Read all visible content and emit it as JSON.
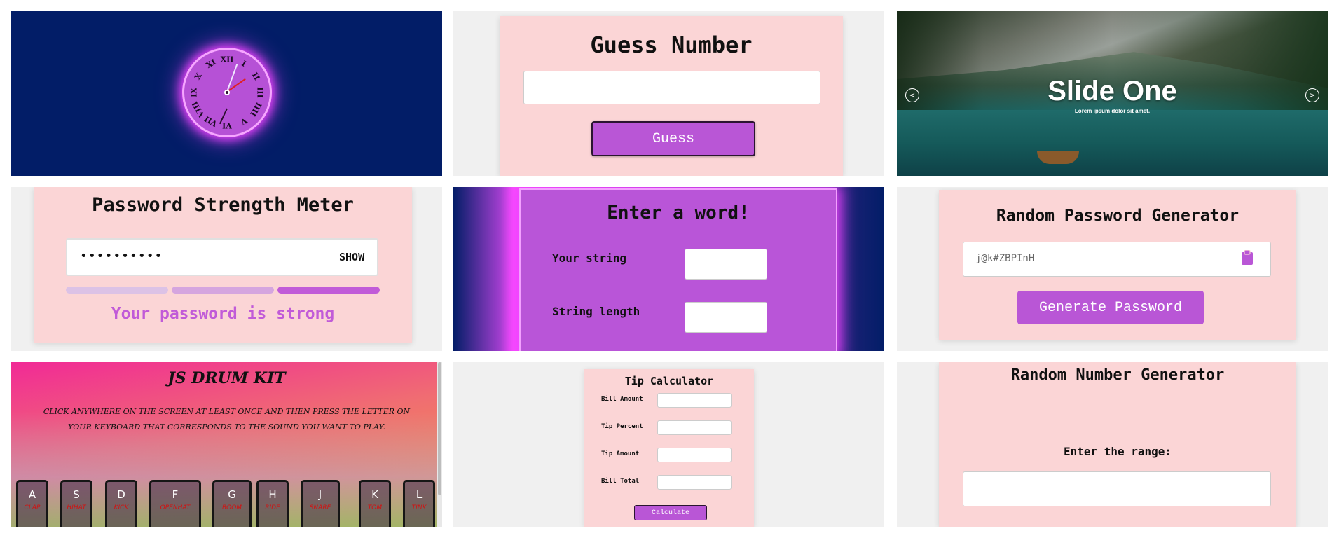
{
  "clock": {
    "numerals": [
      "XII",
      "I",
      "II",
      "III",
      "IIII",
      "V",
      "VI",
      "VII",
      "VIII",
      "IX",
      "X",
      "XI"
    ]
  },
  "guess": {
    "title": "Guess Number",
    "button": "Guess",
    "input_value": ""
  },
  "slider": {
    "title": "Slide One",
    "subtitle": "Lorem ipsum dolor sit amet.",
    "prev": "<",
    "next": ">"
  },
  "password_meter": {
    "title": "Password Strength Meter",
    "value": "••••••••••",
    "toggle": "SHOW",
    "strength_text": "Your password is strong",
    "strength_level": 3,
    "strength_max": 3
  },
  "word": {
    "title": "Enter a word!",
    "string_label": "Your string",
    "length_label": "String length"
  },
  "generator": {
    "title": "Random Password Generator",
    "password": "j@k#ZBPInH",
    "button": "Generate Password"
  },
  "drum": {
    "title": "JS Drum Kit",
    "instructions": "Click anywhere on the screen at least once and then press the letter on your keyboard that corresponds to the sound you want to play.",
    "keys": [
      {
        "key": "A",
        "sound": "clap"
      },
      {
        "key": "S",
        "sound": "hihat"
      },
      {
        "key": "D",
        "sound": "kick"
      },
      {
        "key": "F",
        "sound": "openhat"
      },
      {
        "key": "G",
        "sound": "boom"
      },
      {
        "key": "H",
        "sound": "ride"
      },
      {
        "key": "J",
        "sound": "snare"
      },
      {
        "key": "K",
        "sound": "tom"
      },
      {
        "key": "L",
        "sound": "tink"
      }
    ]
  },
  "tip": {
    "title": "Tip Calculator",
    "fields": [
      "Bill Amount",
      "Tip Percent",
      "Tip Amount",
      "Bill Total"
    ],
    "button": "Calculate"
  },
  "rng": {
    "title": "Random Number Generator",
    "range_label": "Enter the range:"
  },
  "colors": {
    "pink_card": "#fbd5d6",
    "purple": "#b956d6",
    "navy": "#021d67"
  }
}
